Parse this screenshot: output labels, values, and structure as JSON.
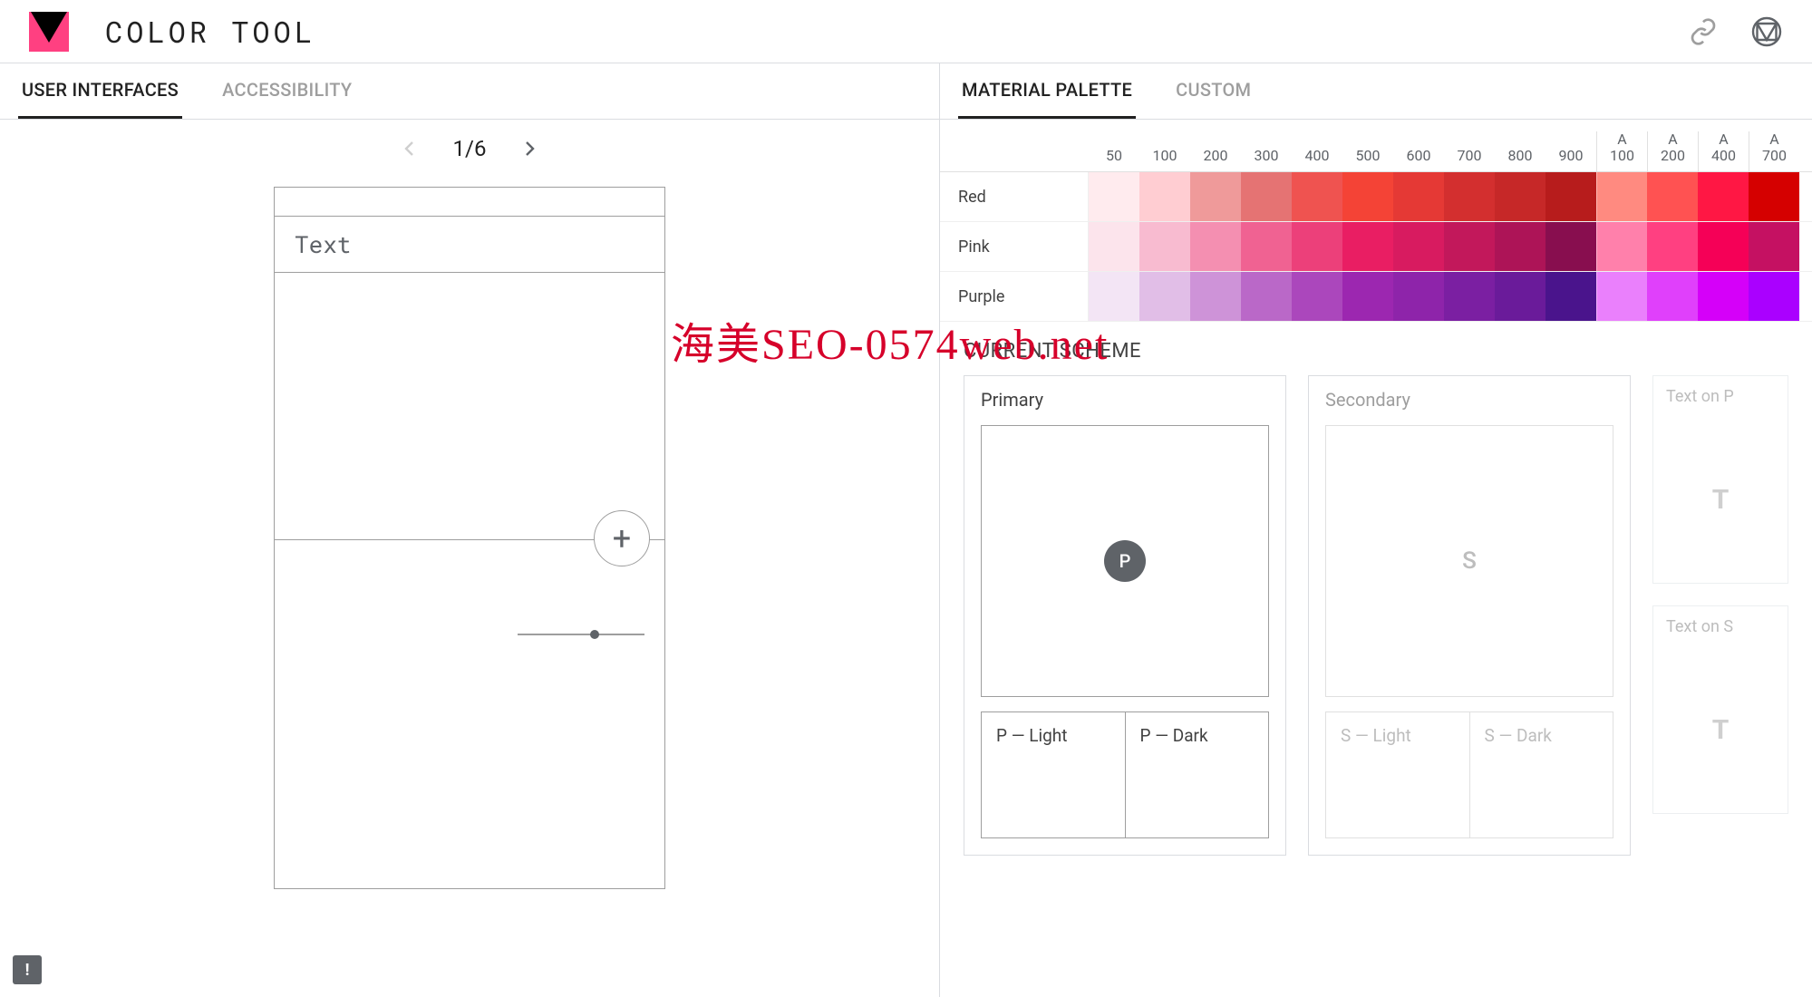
{
  "app_title": "COLOR TOOL",
  "left_tabs": [
    "USER INTERFACES",
    "ACCESSIBILITY"
  ],
  "left_active_tab": 0,
  "pager": {
    "current": 1,
    "total": 6,
    "label": "1/6"
  },
  "phone": {
    "appbar_text": "Text",
    "fab_glyph": "+"
  },
  "right_tabs": [
    "MATERIAL PALETTE",
    "CUSTOM"
  ],
  "right_active_tab": 0,
  "shade_headers": [
    "50",
    "100",
    "200",
    "300",
    "400",
    "500",
    "600",
    "700",
    "800",
    "900"
  ],
  "accent_headers": [
    "100",
    "200",
    "400",
    "700"
  ],
  "accent_prefix": "A",
  "hues": [
    {
      "name": "Red",
      "shades": [
        "#ffebee",
        "#ffcdd2",
        "#ef9a9a",
        "#e57373",
        "#ef5350",
        "#f44336",
        "#e53935",
        "#d32f2f",
        "#c62828",
        "#b71c1c"
      ],
      "accents": [
        "#ff8a80",
        "#ff5252",
        "#ff1744",
        "#d50000"
      ]
    },
    {
      "name": "Pink",
      "shades": [
        "#fce4ec",
        "#f8bbd0",
        "#f48fb1",
        "#f06292",
        "#ec407a",
        "#e91e63",
        "#d81b60",
        "#c2185b",
        "#ad1457",
        "#880e4f"
      ],
      "accents": [
        "#ff80ab",
        "#ff4081",
        "#f50057",
        "#c51162"
      ]
    },
    {
      "name": "Purple",
      "shades": [
        "#f3e5f5",
        "#e1bee7",
        "#ce93d8",
        "#ba68c8",
        "#ab47bc",
        "#9c27b0",
        "#8e24aa",
        "#7b1fa2",
        "#6a1b9a",
        "#4a148c"
      ],
      "accents": [
        "#ea80fc",
        "#e040fb",
        "#d500f9",
        "#aa00ff"
      ]
    }
  ],
  "scheme_title": "CURRENT SCHEME",
  "scheme": {
    "primary": {
      "title": "Primary",
      "badge": "P",
      "light_label": "P — Light",
      "dark_label": "P — Dark"
    },
    "secondary": {
      "title": "Secondary",
      "badge": "S",
      "light_label": "S — Light",
      "dark_label": "S — Dark"
    },
    "text_on_p": {
      "title": "Text on P",
      "glyph": "T"
    },
    "text_on_s": {
      "title": "Text on S",
      "glyph": "T"
    }
  },
  "watermark": "海美SEO-0574web.net",
  "feedback_glyph": "!"
}
